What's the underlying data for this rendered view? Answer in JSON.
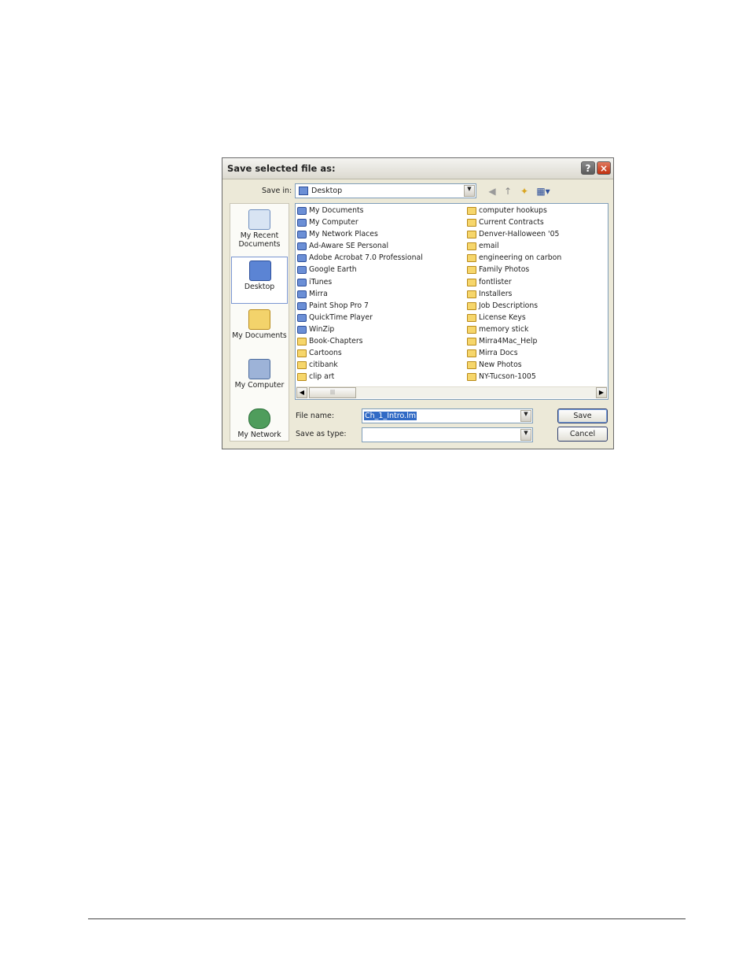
{
  "dialog": {
    "title": "Save selected file as:",
    "help_label": "?",
    "close_label": "×"
  },
  "save_in": {
    "label": "Save in:",
    "value": "Desktop",
    "arrow": "▼"
  },
  "toolbar": {
    "back_icon": "◀",
    "up_icon": "↑",
    "new_folder_icon": "✦",
    "views_icon": "▦▾"
  },
  "places": [
    {
      "label": "My Recent Documents",
      "icon": "recent-documents-icon"
    },
    {
      "label": "Desktop",
      "icon": "desktop-icon",
      "selected": true
    },
    {
      "label": "My Documents",
      "icon": "my-documents-icon"
    },
    {
      "label": "My Computer",
      "icon": "my-computer-icon"
    },
    {
      "label": "My Network",
      "icon": "my-network-icon"
    }
  ],
  "files_col1": [
    {
      "name": "My Documents",
      "type": "app"
    },
    {
      "name": "My Computer",
      "type": "app"
    },
    {
      "name": "My Network Places",
      "type": "app"
    },
    {
      "name": "Ad-Aware SE Personal",
      "type": "app"
    },
    {
      "name": "Adobe Acrobat 7.0 Professional",
      "type": "app"
    },
    {
      "name": "Google Earth",
      "type": "app"
    },
    {
      "name": "iTunes",
      "type": "app"
    },
    {
      "name": "Mirra",
      "type": "app"
    },
    {
      "name": "Paint Shop Pro 7",
      "type": "app"
    },
    {
      "name": "QuickTime Player",
      "type": "app"
    },
    {
      "name": "WinZip",
      "type": "app"
    },
    {
      "name": "Book-Chapters",
      "type": "folder"
    },
    {
      "name": "Cartoons",
      "type": "folder"
    },
    {
      "name": "citibank",
      "type": "folder"
    },
    {
      "name": "clip art",
      "type": "folder"
    }
  ],
  "files_col2": [
    {
      "name": "computer hookups",
      "type": "folder"
    },
    {
      "name": "Current Contracts",
      "type": "folder"
    },
    {
      "name": "Denver-Halloween '05",
      "type": "folder"
    },
    {
      "name": "email",
      "type": "folder"
    },
    {
      "name": "engineering on carbon",
      "type": "folder"
    },
    {
      "name": "Family Photos",
      "type": "folder"
    },
    {
      "name": "fontlister",
      "type": "folder"
    },
    {
      "name": "Installers",
      "type": "folder"
    },
    {
      "name": "Job Descriptions",
      "type": "folder"
    },
    {
      "name": "License Keys",
      "type": "folder"
    },
    {
      "name": "memory stick",
      "type": "folder"
    },
    {
      "name": "Mirra4Mac_Help",
      "type": "folder"
    },
    {
      "name": "Mirra Docs",
      "type": "folder"
    },
    {
      "name": "New Photos",
      "type": "folder"
    },
    {
      "name": "NY-Tucson-1005",
      "type": "folder"
    }
  ],
  "scrollbar": {
    "left_arrow": "◀",
    "right_arrow": "▶",
    "thumb_grip": "|||"
  },
  "file_name": {
    "label": "File name:",
    "value": "Ch_1_Intro.lm"
  },
  "save_as_type": {
    "label": "Save as type:",
    "value": ""
  },
  "buttons": {
    "save": "Save",
    "cancel": "Cancel"
  }
}
